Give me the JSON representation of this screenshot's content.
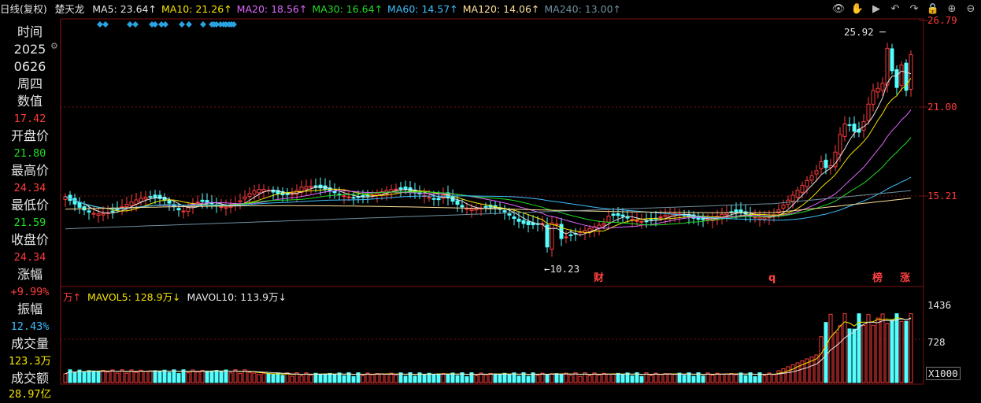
{
  "title": {
    "period": "日线(复权)",
    "stock": "楚天龙",
    "ma": [
      {
        "label": "MA5: 23.64↑",
        "color": "#e6e6e6"
      },
      {
        "label": "MA10: 21.26↑",
        "color": "#f5e400"
      },
      {
        "label": "MA20: 18.56↑",
        "color": "#e066ff"
      },
      {
        "label": "MA30: 16.64↑",
        "color": "#22dd22"
      },
      {
        "label": "MA60: 14.57↑",
        "color": "#3fbfff"
      },
      {
        "label": "MA120: 14.06↑",
        "color": "#ffe09a"
      },
      {
        "label": "MA240: 13.00↑",
        "color": "#6f8fa0"
      }
    ]
  },
  "toolbar": [
    "eye-icon",
    "hand-icon",
    "play-icon",
    "undo-icon",
    "redo-icon",
    "lock-icon",
    "zoom-in-icon",
    "zoom-out-icon"
  ],
  "toolbar_glyphs": [
    "👁",
    "✋",
    "▶",
    "↶",
    "↷",
    "🔒",
    "⊕",
    "⊖"
  ],
  "info_panel": {
    "time_label": "时间",
    "year": "2025",
    "date": "0626",
    "weekday": "周四",
    "value_label": "数值",
    "value": "17.42",
    "open_label": "开盘价",
    "open": "21.80",
    "high_label": "最高价",
    "high": "24.34",
    "low_label": "最低价",
    "low": "21.59",
    "close_label": "收盘价",
    "close": "24.34",
    "change_label": "涨幅",
    "change": "+9.99%",
    "amplitude_label": "振幅",
    "amplitude": "12.43%",
    "volume_label": "成交量",
    "volume": "123.3万",
    "amount_label": "成交额",
    "amount": "28.97亿"
  },
  "volume_header": {
    "unit": "万↑",
    "mavol5": "MAVOL5: 128.9万↓",
    "mavol10": "MAVOL10: 113.9万↓"
  },
  "chart_data": {
    "type": "candlestick",
    "price_axis": {
      "ticks": [
        "26.79",
        "21.00",
        "15.21"
      ],
      "ylim": [
        8.9,
        26.79
      ]
    },
    "volume_axis": {
      "ticks": [
        "1436",
        "728"
      ],
      "multiplier": "X1000"
    },
    "annotations": {
      "high": "25.92",
      "low": "10.23"
    },
    "event_markers": [
      {
        "label": "财",
        "color": "#ff4040"
      },
      {
        "label": "q",
        "color": "#ff4040"
      },
      {
        "label": "榜",
        "color": "#ff4040"
      },
      {
        "label": "涨",
        "color": "#ff4040"
      }
    ],
    "colors": {
      "up": "#ff3b3b",
      "down": "#54ffff",
      "grid": "#7a1010",
      "axis_text": "#ff3b3b",
      "diamond": "#2aa3e0"
    }
  }
}
